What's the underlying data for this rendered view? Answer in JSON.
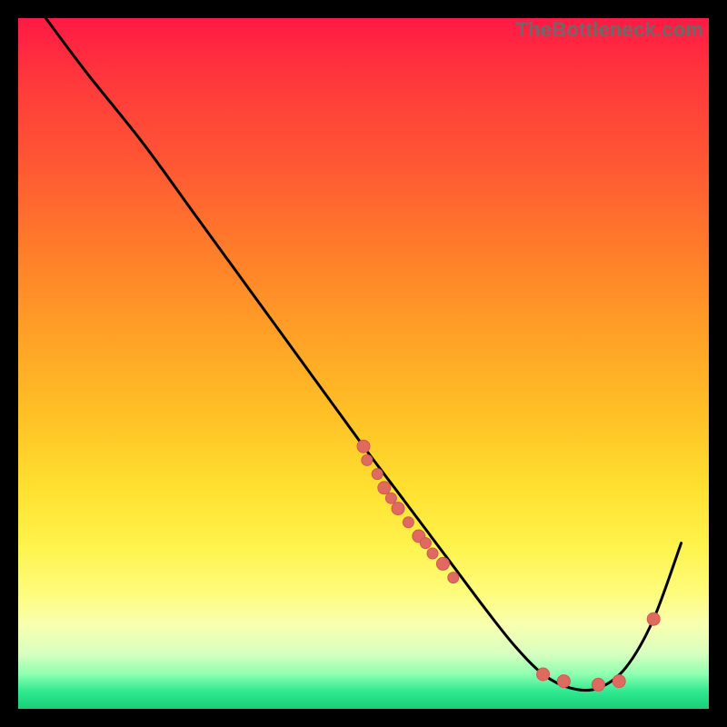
{
  "watermark": "TheBottleneck.com",
  "colors": {
    "curve": "#000000",
    "dot_fill": "#e06a60",
    "dot_stroke": "#d05a50"
  },
  "chart_data": {
    "type": "line",
    "title": "",
    "xlabel": "",
    "ylabel": "",
    "xlim": [
      0,
      100
    ],
    "ylim": [
      0,
      100
    ],
    "grid": false,
    "series": [
      {
        "name": "bottleneck-curve",
        "x": [
          4,
          10,
          18,
          26,
          34,
          42,
          50,
          56,
          62,
          68,
          72,
          76,
          80,
          84,
          88,
          92,
          96
        ],
        "y": [
          100,
          92,
          82,
          71,
          60,
          49,
          38,
          30,
          22,
          14,
          9,
          5,
          3,
          3,
          6,
          13,
          24
        ]
      }
    ],
    "points": [
      {
        "name": "cluster-upper",
        "x": 50,
        "y": 38,
        "r": 7
      },
      {
        "name": "cluster-upper",
        "x": 50.5,
        "y": 36,
        "r": 6
      },
      {
        "name": "cluster-upper",
        "x": 52,
        "y": 34,
        "r": 6
      },
      {
        "name": "cluster-upper",
        "x": 53,
        "y": 32,
        "r": 7
      },
      {
        "name": "cluster-upper",
        "x": 54,
        "y": 30.5,
        "r": 6
      },
      {
        "name": "cluster-upper",
        "x": 55,
        "y": 29,
        "r": 7
      },
      {
        "name": "cluster-upper",
        "x": 56.5,
        "y": 27,
        "r": 6
      },
      {
        "name": "cluster-upper",
        "x": 58,
        "y": 25,
        "r": 7
      },
      {
        "name": "cluster-upper",
        "x": 59,
        "y": 24,
        "r": 6
      },
      {
        "name": "cluster-upper",
        "x": 60,
        "y": 22.5,
        "r": 6
      },
      {
        "name": "cluster-upper",
        "x": 61.5,
        "y": 21,
        "r": 7
      },
      {
        "name": "cluster-upper",
        "x": 63,
        "y": 19,
        "r": 6
      },
      {
        "name": "basin-dot",
        "x": 76,
        "y": 5,
        "r": 7
      },
      {
        "name": "basin-dot",
        "x": 79,
        "y": 4,
        "r": 7
      },
      {
        "name": "basin-dot",
        "x": 84,
        "y": 3.5,
        "r": 7
      },
      {
        "name": "basin-dot",
        "x": 87,
        "y": 4,
        "r": 7
      },
      {
        "name": "rise-dot",
        "x": 92,
        "y": 13,
        "r": 7
      }
    ]
  }
}
